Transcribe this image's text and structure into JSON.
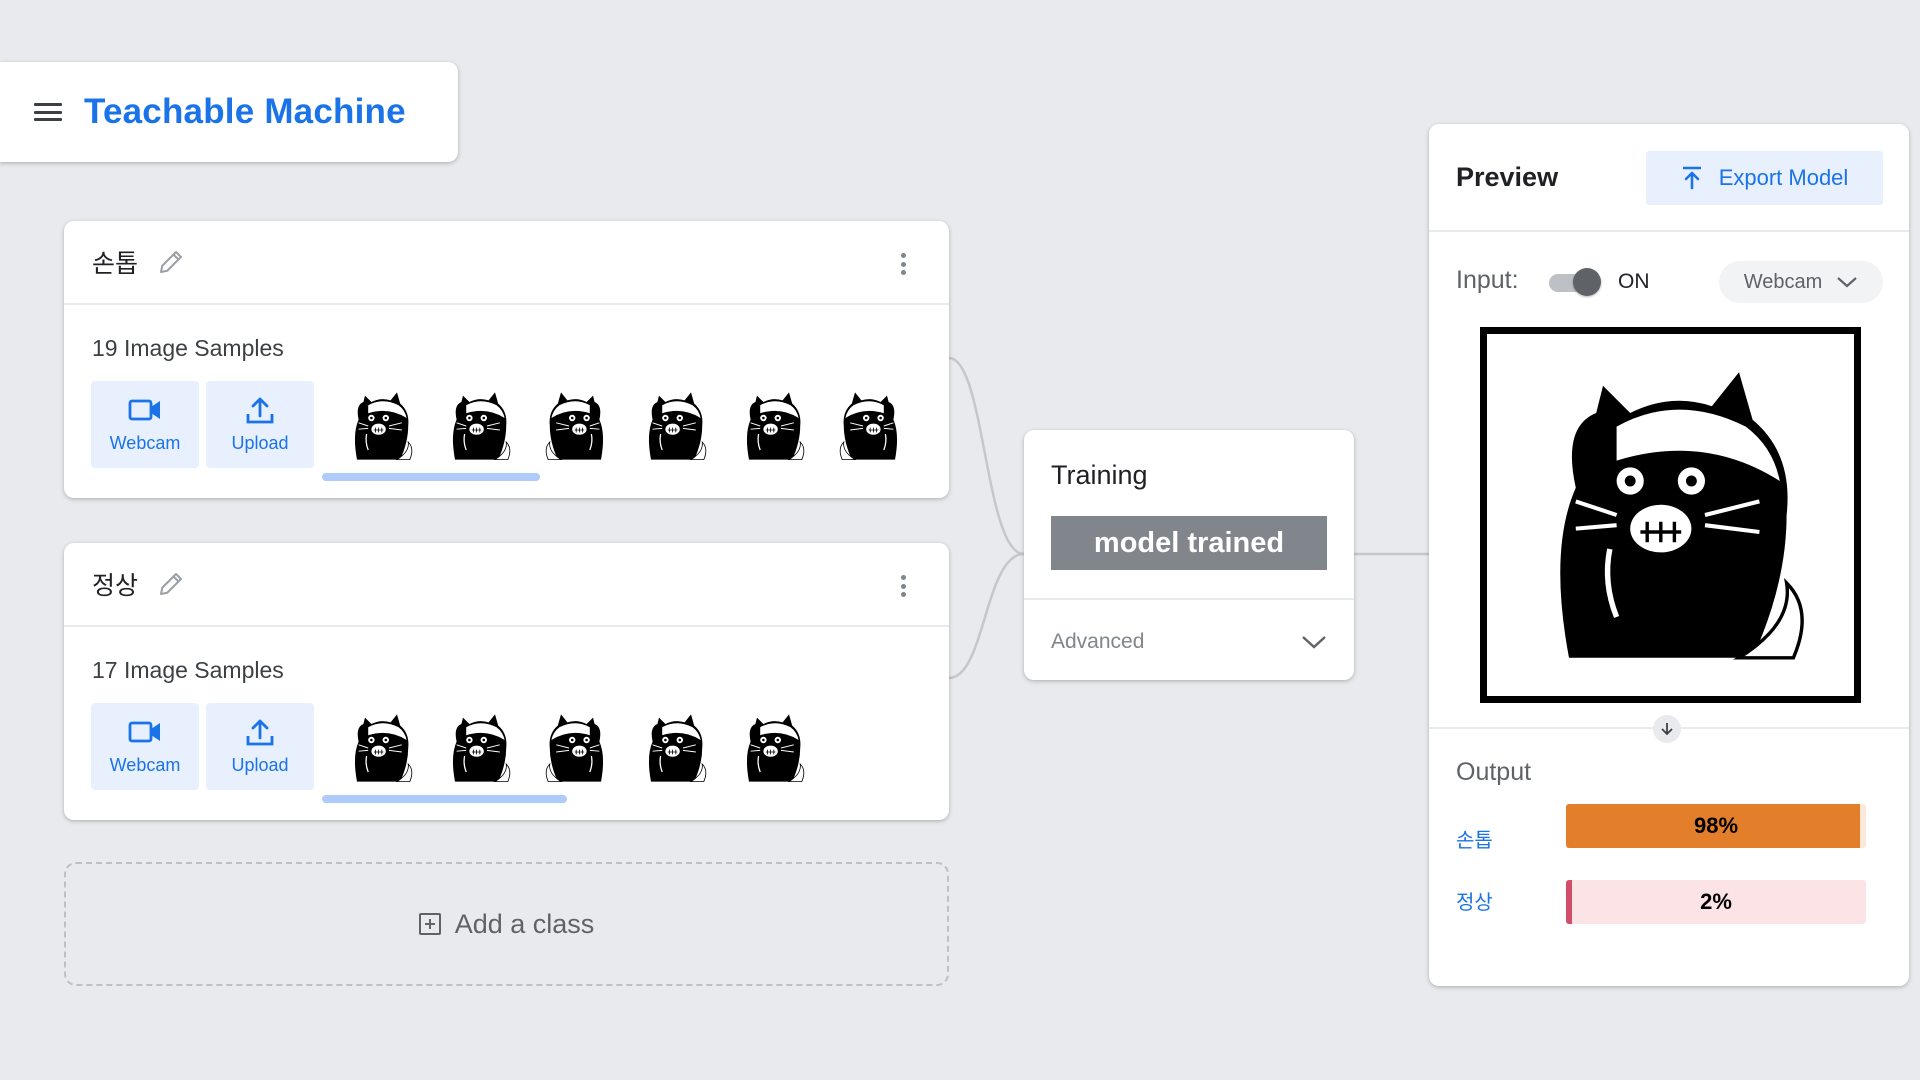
{
  "app": {
    "title": "Teachable Machine"
  },
  "classes": [
    {
      "name": "손톱",
      "samples_label": "19 Image Samples",
      "webcam_label": "Webcam",
      "upload_label": "Upload",
      "visible_thumbnails": 6
    },
    {
      "name": "정상",
      "samples_label": "17 Image Samples",
      "webcam_label": "Webcam",
      "upload_label": "Upload",
      "visible_thumbnails": 5
    }
  ],
  "add_class": {
    "label": "Add a class"
  },
  "training": {
    "title": "Training",
    "button_label": "model trained",
    "advanced_label": "Advanced"
  },
  "preview": {
    "title": "Preview",
    "export_label": "Export Model",
    "input_label": "Input:",
    "toggle_label": "ON",
    "toggle_on": true,
    "source_label": "Webcam",
    "output_title": "Output",
    "outputs": [
      {
        "label": "손톱",
        "percent_text": "98%",
        "value": 0.98,
        "color": "#e37e2a",
        "bg": "#fce8d9"
      },
      {
        "label": "정상",
        "percent_text": "2%",
        "value": 0.02,
        "color": "#d14d6a",
        "bg": "#fbe3e6"
      }
    ]
  },
  "colors": {
    "accent": "#1a73e8",
    "background": "#e8eaed",
    "train_button": "#80868b"
  }
}
